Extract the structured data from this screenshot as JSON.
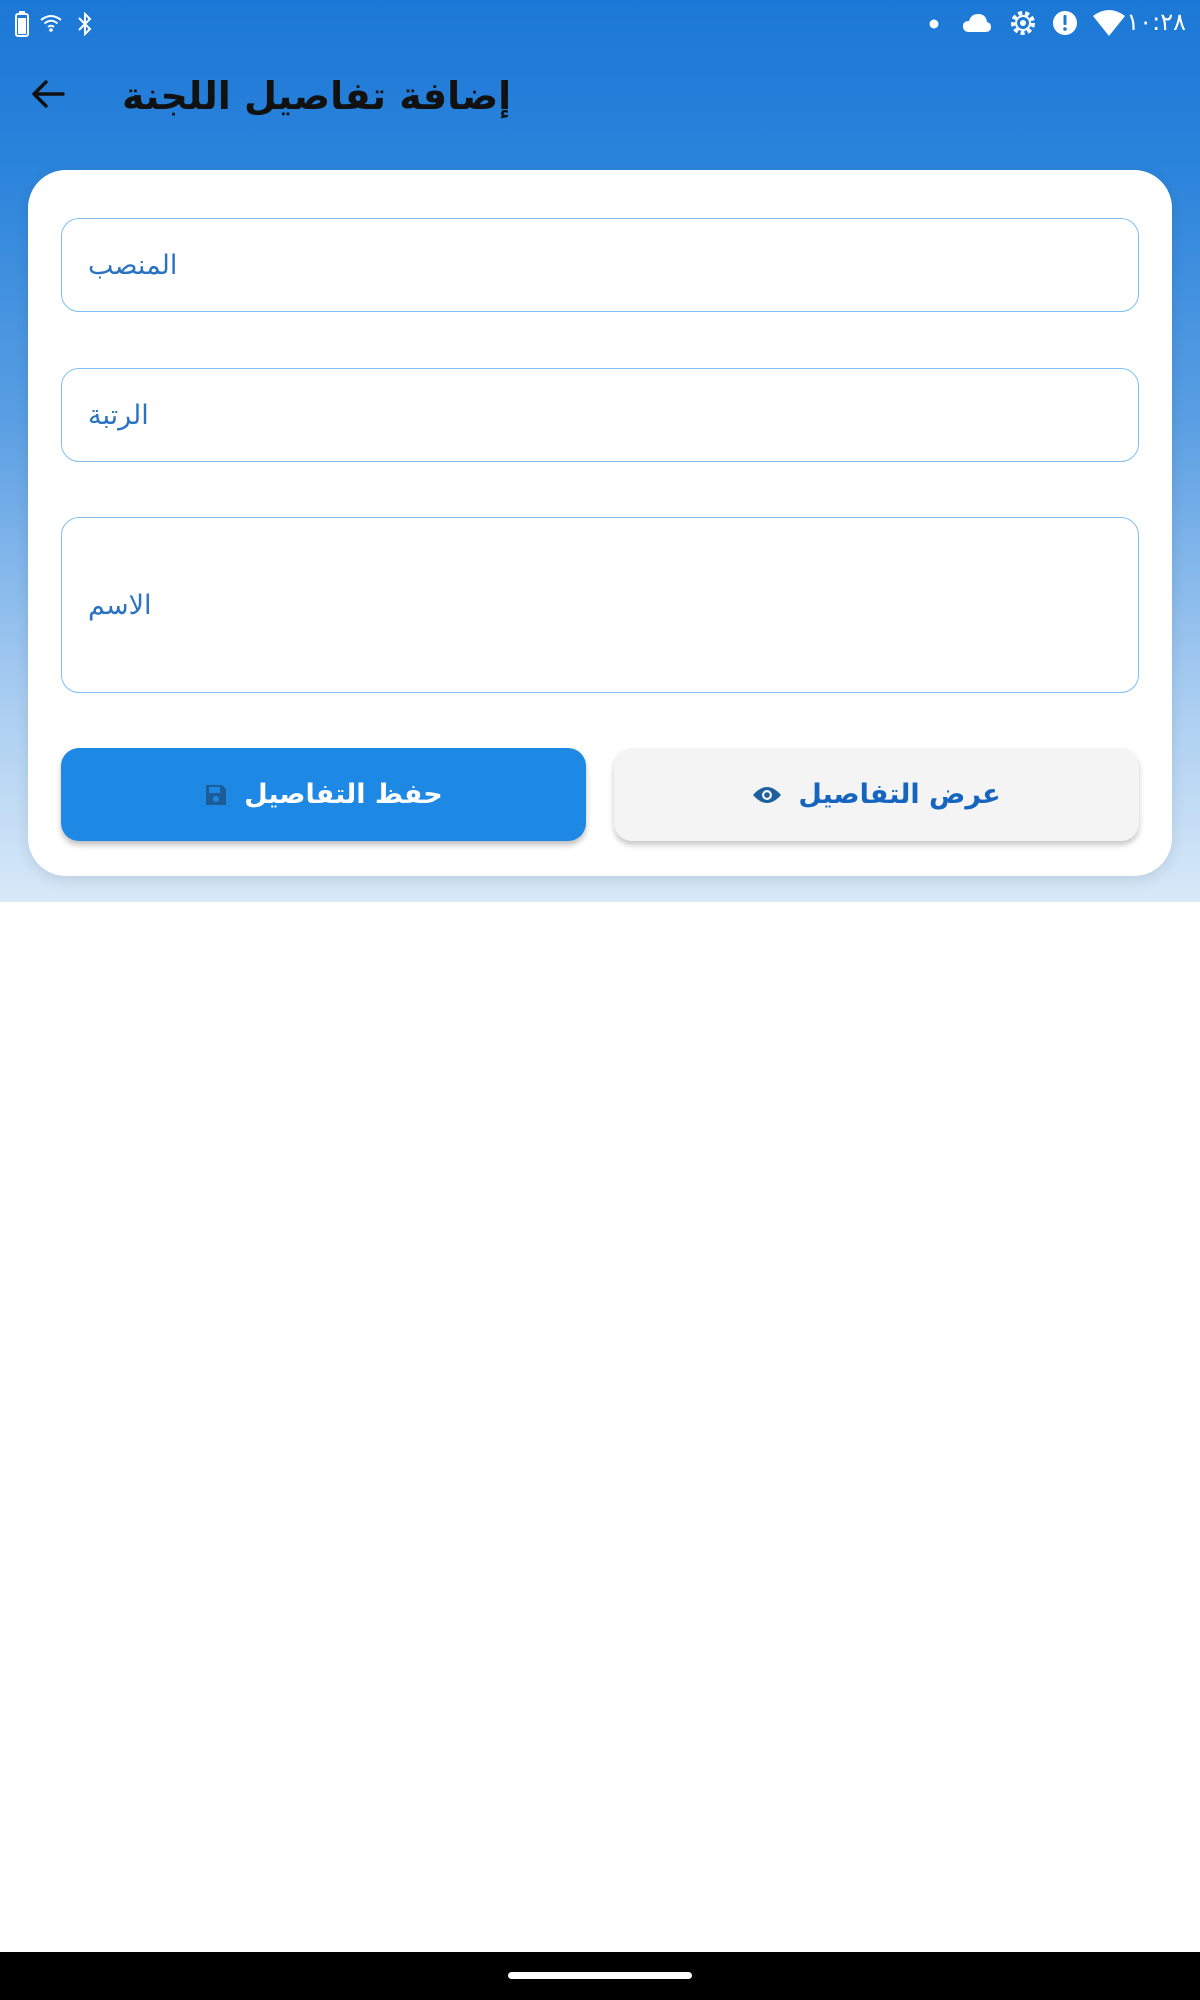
{
  "status_bar": {
    "time": "١٠:٢٨",
    "icons": [
      "battery-icon",
      "wifi-small-icon",
      "bluetooth-icon",
      "dot-icon",
      "cloud-icon",
      "settings-gear-icon",
      "alert-icon",
      "wifi-icon"
    ]
  },
  "app_bar": {
    "title": "إضافة تفاصيل اللجنة",
    "back_icon": "arrow-back-icon"
  },
  "form": {
    "position_placeholder": "المنصب",
    "rank_placeholder": "الرتبة",
    "name_placeholder": "الاسم"
  },
  "buttons": {
    "save_label": "حفظ التفاصيل",
    "save_icon": "save-icon",
    "view_label": "عرض التفاصيل",
    "view_icon": "eye-icon"
  },
  "colors": {
    "primary": "#1e88e5",
    "header_top": "#1c78d6",
    "field_border": "#7fbff3",
    "view_text": "#1565c0"
  }
}
